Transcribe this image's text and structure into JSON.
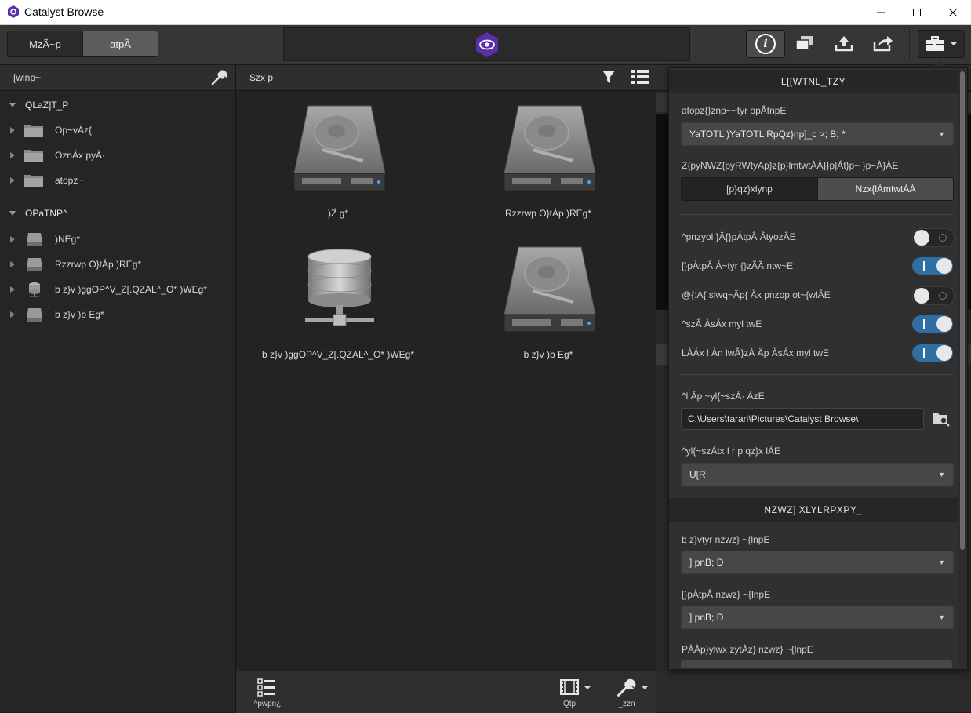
{
  "app": {
    "title": "Catalyst Browse"
  },
  "window": {
    "minimize": "—",
    "maximize": "☐",
    "close": "✕"
  },
  "toolbar": {
    "seg_left": "MzÃ~p",
    "seg_right": "atpÃ",
    "info_icon": "i"
  },
  "left_panel": {
    "header": "[wlnp~",
    "group1": {
      "title": "QLaZ]T_P",
      "items": [
        {
          "label": "Op~vÀz{"
        },
        {
          "label": "OznÁx pyÀ·"
        },
        {
          "label": "atopz~"
        }
      ]
    },
    "group2": {
      "title": "OPaTNP^",
      "items": [
        {
          "label": ")NEg*"
        },
        {
          "label": "Rzzrwp O}tÂp )REg*"
        },
        {
          "label": "b z}v )ggOP^V_Z[.QZAL^_O* )WEg*"
        },
        {
          "label": "b z}v )b Eg*"
        }
      ]
    }
  },
  "browser": {
    "header": "Szx p",
    "tiles": [
      {
        "label": ")Ž g*",
        "icon": "hard-drive-icon"
      },
      {
        "label": "Rzzrwp O}tÂp )REg*",
        "icon": "hard-drive-icon"
      },
      {
        "label": "b z}v )ggOP^V_Z[.QZAL^_O* )WEg*",
        "icon": "network-database-icon"
      },
      {
        "label": "b z}v )b Eg*",
        "icon": "hard-drive-icon"
      }
    ],
    "bottom": {
      "left_label": "^pwpn¿",
      "mid_label": "Qtp",
      "right_label": "_zzn"
    }
  },
  "settings": {
    "header_general": "L[[WTNL_TZY",
    "thumb_label": "atopz{}znp~~tyr opÂtnpE",
    "thumb_value": "YaTOTL )YaTOTL RpQz}np]_c >; B; *",
    "segment_label": "Z{pyNWZ{pyRWtyAp}z{p}lmtwtÀÀ}}p|Át}p~ }p~À}ÀE",
    "segment_a": "[p}qz}xlynp",
    "segment_b": "Nzx{lÀmtwtÀÀ",
    "toggles": [
      {
        "label": "^pnzyol }Ä{}pÀtpÂ ÂtyozÂE",
        "on": false
      },
      {
        "label": "[}pÀtpÂ Á~tyr {}zÃÃ ntw~E",
        "on": true
      },
      {
        "label": "@{:A{ slwq~Äp{ Àx pnzop ot~{wlÂE",
        "on": false
      },
      {
        "label": "^szÂ ÀsÁx myl twE",
        "on": true
      },
      {
        "label": "LÀÁx l Àn lwÂ}zÀ Äp ÀsÁx myl twE",
        "on": true
      }
    ],
    "snapshot_label": "^l Âp ~yl{~szÀ· ÀzE",
    "snapshot_path": "C:\\Users\\taran\\Pictures\\Catalyst Browse\\",
    "format_label": "^yl{~szÀtx l r p qz}x lÀE",
    "format_value": "U[R",
    "header_monitor": "NZWZ] XLYLRPXPY_",
    "mon1_label": "b z}vtyr nzwz} ~{lnpE",
    "mon1_value": "] pnB; D",
    "mon2_label": "[}pÀtpÂ nzwz} ~{lnpE",
    "mon2_value": "] pnB; D",
    "mon3_label": "PÀÀp}ylwx zytÀz} nzwz} ~{lnpE"
  }
}
